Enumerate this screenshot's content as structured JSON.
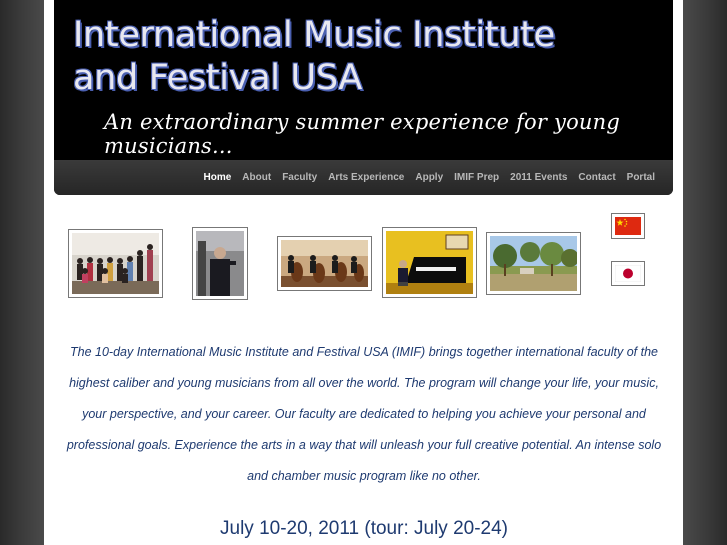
{
  "header": {
    "title_line1": "International Music Institute",
    "title_line2": "and Festival USA",
    "tagline": "An extraordinary summer experience for young musicians..."
  },
  "nav": {
    "items": [
      {
        "label": "Home",
        "active": true
      },
      {
        "label": "About"
      },
      {
        "label": "Faculty"
      },
      {
        "label": "Arts Experience"
      },
      {
        "label": "Apply"
      },
      {
        "label": "IMIF Prep"
      },
      {
        "label": "2011 Events"
      },
      {
        "label": "Contact"
      },
      {
        "label": "Portal"
      }
    ]
  },
  "flags": {
    "china": "china-flag-icon",
    "japan": "japan-flag-icon"
  },
  "main": {
    "intro": "The 10-day International Music Institute and Festival USA (IMIF) brings together international faculty of the highest caliber and young musicians from all over the world. The program will change your life, your music, your perspective, and your career. Our faculty are dedicated to helping you achieve your personal and professional goals. Experience the arts in a way that will unleash your full creative potential. An intense solo and chamber music program like no other.",
    "dates": "July 10-20, 2011 (tour: July 20-24)"
  },
  "colors": {
    "header_bg": "#000000",
    "title_outline": "#4a5fb0",
    "body_text": "#1e3a70"
  }
}
